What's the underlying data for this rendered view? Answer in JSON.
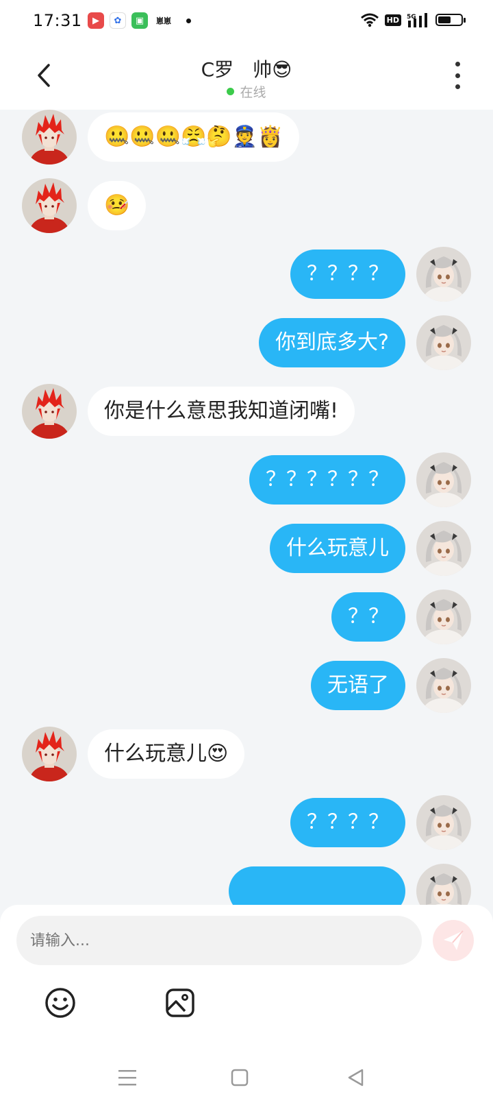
{
  "status_bar": {
    "time": "17:31",
    "app_text": "崽崽",
    "network": "5G",
    "hd_label": "HD",
    "battery_level": 0.55
  },
  "header": {
    "title": "C罗　帅😎",
    "status": "在线"
  },
  "messages": [
    {
      "side": "left",
      "text": "🤐🤐🤐😤🤔👮👸"
    },
    {
      "side": "left",
      "text": "🤒"
    },
    {
      "side": "right",
      "text": "？？？？"
    },
    {
      "side": "right",
      "text": "你到底多大?"
    },
    {
      "side": "left",
      "text": "你是什么意思我知道闭嘴!"
    },
    {
      "side": "right",
      "text": "？？？？？？"
    },
    {
      "side": "right",
      "text": "什么玩意儿"
    },
    {
      "side": "right",
      "text": "？？"
    },
    {
      "side": "right",
      "text": "无语了"
    },
    {
      "side": "left",
      "text": "什么玩意儿😍"
    },
    {
      "side": "right",
      "text": "？？？？"
    },
    {
      "side": "right",
      "text": ""
    }
  ],
  "input": {
    "placeholder": "请输入..."
  },
  "colors": {
    "accent": "#29b6f6",
    "background": "#f3f5f7",
    "online": "#3ccb4b",
    "send_disabled": "#fde6e6"
  },
  "icons": {
    "back": "chevron-left-icon",
    "more": "more-vertical-icon",
    "send": "send-icon",
    "emoji": "emoji-icon",
    "image": "image-icon"
  }
}
